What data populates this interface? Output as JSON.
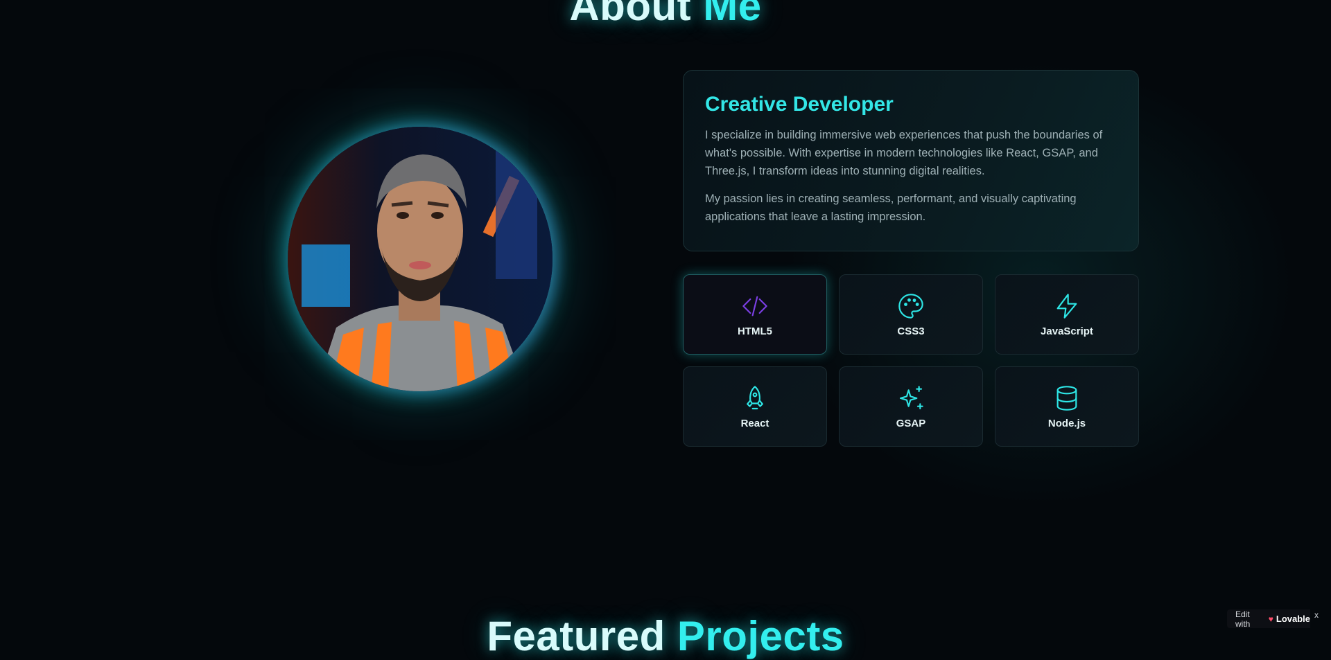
{
  "about": {
    "title_part1": "About",
    "title_part2": "Me"
  },
  "profile": {
    "card_title": "Creative Developer",
    "paragraph1": "I specialize in building immersive web experiences that push the boundaries of what's possible. With expertise in modern technologies like React, GSAP, and Three.js, I transform ideas into stunning digital realities.",
    "paragraph2": "My passion lies in creating seamless, performant, and visually captivating applications that leave a lasting impression."
  },
  "skills": [
    {
      "label": "HTML5",
      "icon": "code-icon",
      "color": "#7b3fe4"
    },
    {
      "label": "CSS3",
      "icon": "palette-icon",
      "color": "#2ee6e6"
    },
    {
      "label": "JavaScript",
      "icon": "zap-icon",
      "color": "#2ee6e6"
    },
    {
      "label": "React",
      "icon": "rocket-icon",
      "color": "#2ee6e6"
    },
    {
      "label": "GSAP",
      "icon": "sparkles-icon",
      "color": "#2ee6e6"
    },
    {
      "label": "Node.js",
      "icon": "database-icon",
      "color": "#2ee6e6"
    }
  ],
  "projects": {
    "title_part1": "Featured",
    "title_part2": "Projects"
  },
  "badge": {
    "prefix": "Edit with",
    "brand": "Lovable",
    "close": "x"
  },
  "colors": {
    "accent": "#33e6e6",
    "background": "#04080c",
    "purple": "#7b3fe4"
  }
}
